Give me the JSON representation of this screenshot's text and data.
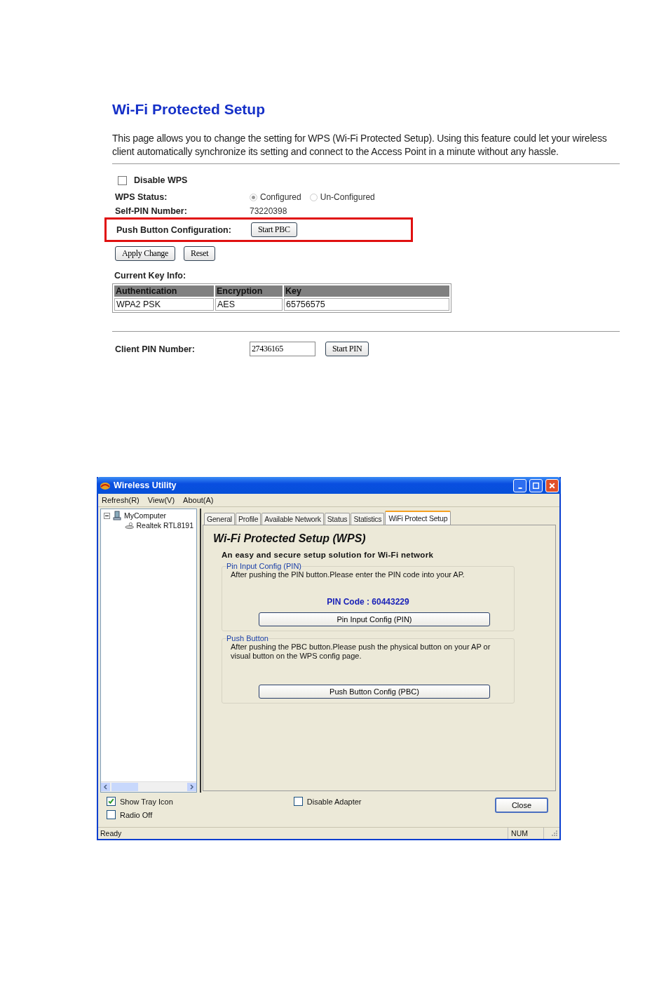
{
  "web": {
    "title": "Wi-Fi Protected Setup",
    "description": "This page allows you to change the setting for WPS (Wi-Fi Protected Setup). Using this feature could let your wireless client automatically synchronize its setting and connect to the Access Point in a minute without any hassle.",
    "disable_wps": {
      "label": "Disable WPS",
      "checked": false
    },
    "wps_status": {
      "label": "WPS Status:",
      "options": [
        {
          "label": "Configured",
          "selected": true
        },
        {
          "label": "Un-Configured",
          "selected": false
        }
      ]
    },
    "self_pin": {
      "label": "Self-PIN Number:",
      "value": "73220398"
    },
    "pbc": {
      "label": "Push Button Configuration:",
      "button": "Start PBC",
      "highlighted": true
    },
    "action_buttons": [
      "Apply Change",
      "Reset"
    ],
    "key_info": {
      "label": "Current Key Info:",
      "columns": [
        "Authentication",
        "Encryption",
        "Key"
      ],
      "rows": [
        [
          "WPA2 PSK",
          "AES",
          "65756575"
        ]
      ]
    },
    "client_pin": {
      "label": "Client PIN Number:",
      "value": "27436165",
      "button": "Start PIN"
    }
  },
  "utility": {
    "title": "Wireless Utility",
    "menu": [
      "Refresh(R)",
      "View(V)",
      "About(A)"
    ],
    "tree": [
      {
        "label": "MyComputer",
        "expanded": true,
        "children": [
          {
            "label": "Realtek RTL8191"
          }
        ]
      }
    ],
    "tabs": [
      {
        "label": "General",
        "selected": false
      },
      {
        "label": "Profile",
        "selected": false
      },
      {
        "label": "Available Network",
        "selected": false
      },
      {
        "label": "Status",
        "selected": false
      },
      {
        "label": "Statistics",
        "selected": false
      },
      {
        "label": "WiFi Protect Setup",
        "selected": true
      }
    ],
    "panel": {
      "title": "Wi-Fi Protected Setup (WPS)",
      "subtitle": "An easy and secure setup solution for Wi-Fi network",
      "pin_group": {
        "legend": "Pin Input Config (PIN)",
        "text": "After pushing the PIN button.Please enter the PIN code into your AP.",
        "code": "PIN Code :  60443229",
        "button": "Pin Input Config (PIN)"
      },
      "push_group": {
        "legend": "Push Button",
        "text": "After pushing the PBC button.Please push the physical button on your AP or visual button on the WPS config page.",
        "button": "Push Button Config (PBC)"
      }
    },
    "options": [
      {
        "label": "Show Tray Icon",
        "checked": true
      },
      {
        "label": "Radio Off",
        "checked": false
      },
      {
        "label": "Disable Adapter",
        "checked": false
      }
    ],
    "close_button": "Close",
    "status_bar": {
      "text": "Ready",
      "indicator": "NUM"
    }
  }
}
